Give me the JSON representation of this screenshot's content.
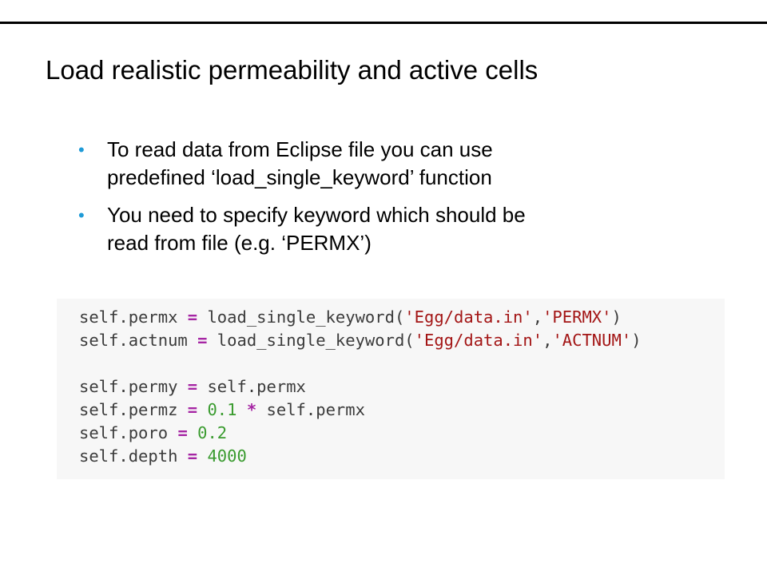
{
  "slide": {
    "title": "Load realistic permeability and active cells",
    "bullets": [
      {
        "line1": "To read data from Eclipse file you can use",
        "line2": "predefined ‘load_single_keyword’ function"
      },
      {
        "line1": "You need to specify keyword which should be",
        "line2": "read from file (e.g. ‘PERMX’)"
      }
    ],
    "bullet_symbol": "•"
  },
  "code": {
    "lines": [
      {
        "var": "self.permx",
        "op": "=",
        "func": "load_single_keyword(",
        "arg1": "'Egg/data.in'",
        "comma": ",",
        "arg2": "'PERMX'",
        "close": ")"
      },
      {
        "var": "self.actnum",
        "op": "=",
        "func": "load_single_keyword(",
        "arg1": "'Egg/data.in'",
        "comma": ",",
        "arg2": "'ACTNUM'",
        "close": ")"
      },
      {
        "var": "self.permy",
        "op": "=",
        "rhs": "self.permx"
      },
      {
        "var": "self.permz",
        "op": "=",
        "num": "0.1",
        "op2": "*",
        "rhs": "self.permx"
      },
      {
        "var": "self.poro",
        "op": "=",
        "num": "0.2"
      },
      {
        "var": "self.depth",
        "op": "=",
        "num": "4000"
      }
    ]
  },
  "colors": {
    "bullet": "#1f9bd7",
    "code_background": "#f7f7f7",
    "operator": "#a626a4",
    "string": "#a31515",
    "number": "#3a9b2f"
  }
}
